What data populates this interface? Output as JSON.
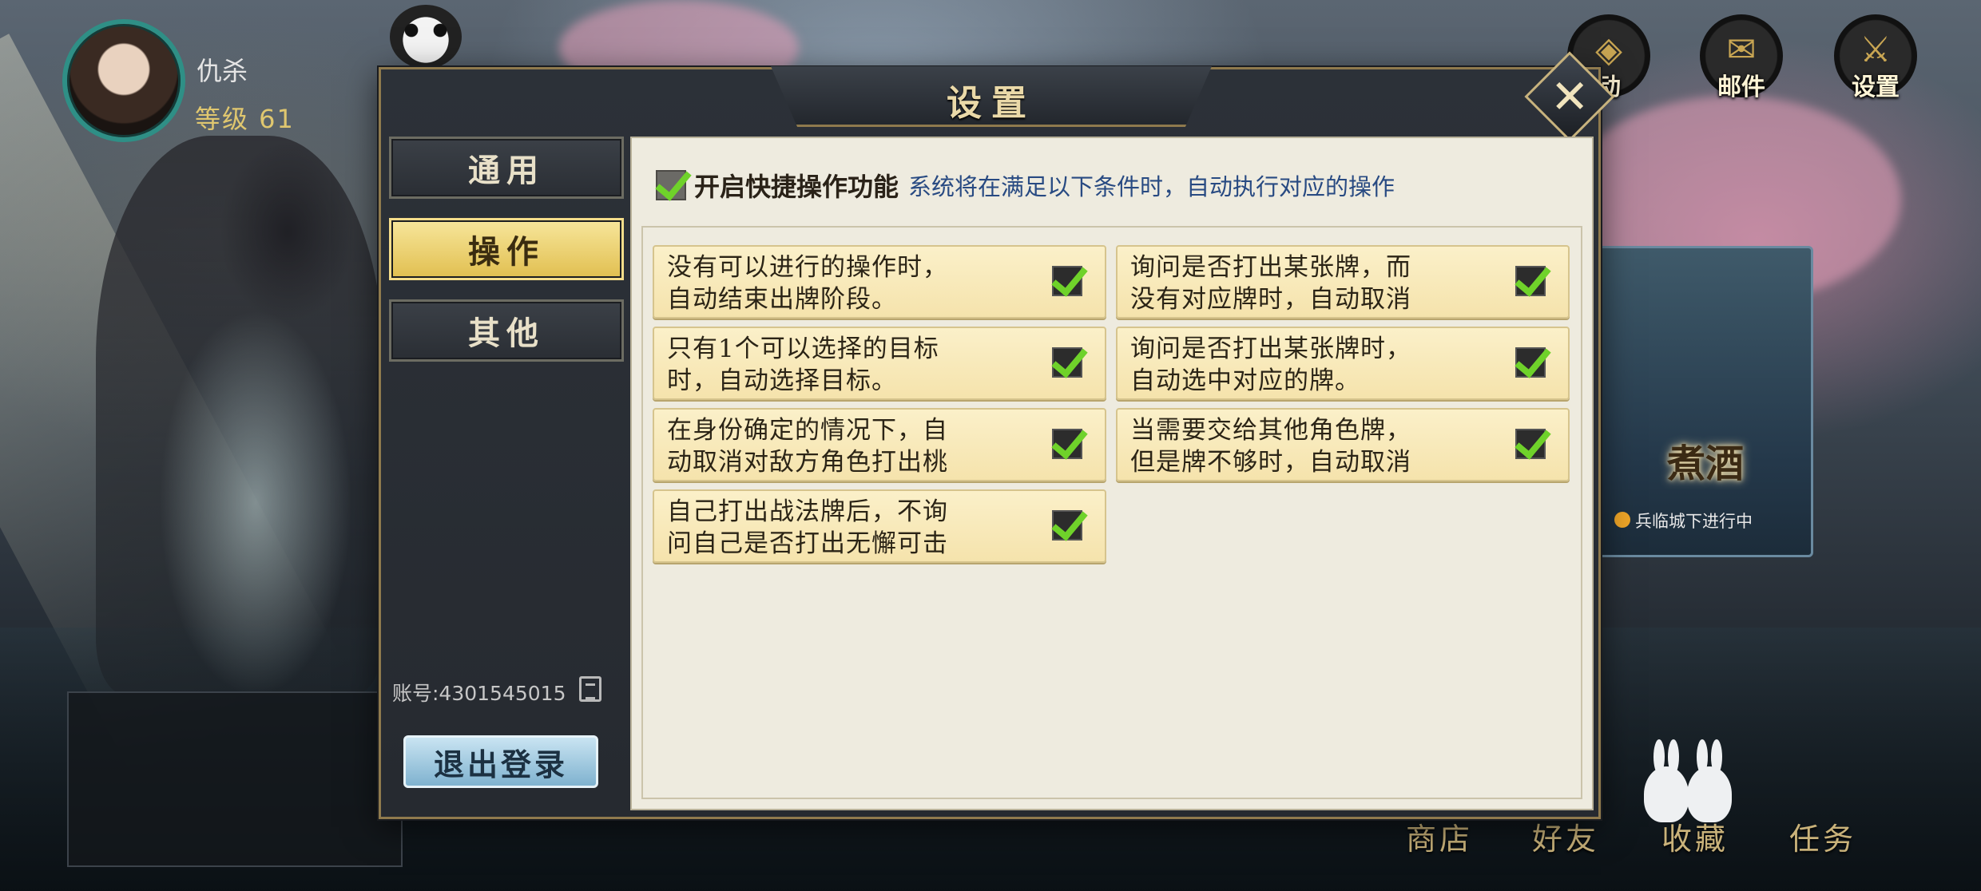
{
  "player": {
    "name": "仇杀",
    "level": "等级 61"
  },
  "top_icons": [
    {
      "name": "activity",
      "label": "动"
    },
    {
      "name": "mail",
      "label": "邮件"
    },
    {
      "name": "settings",
      "label": "设置"
    }
  ],
  "event": {
    "title": "煮酒",
    "subtitle": "兵临城下进行中"
  },
  "bottom_nav": [
    "商店",
    "好友",
    "收藏",
    "任务"
  ],
  "dialog": {
    "title": "设置",
    "tabs": [
      {
        "label": "通用",
        "active": false
      },
      {
        "label": "操作",
        "active": true
      },
      {
        "label": "其他",
        "active": false
      }
    ],
    "account": "账号:4301545015",
    "logout_label": "退出登录",
    "master": {
      "label": "开启快捷操作功能",
      "description": "系统将在满足以下条件时，自动执行对应的操作",
      "checked": true
    },
    "options": [
      {
        "line1": "没有可以进行的操作时，",
        "line2": "自动结束出牌阶段。",
        "checked": true
      },
      {
        "line1": "询问是否打出某张牌，而",
        "line2": "没有对应牌时，自动取消",
        "checked": true
      },
      {
        "line1": "只有1个可以选择的目标",
        "line2": "时，自动选择目标。",
        "checked": true
      },
      {
        "line1": "询问是否打出某张牌时，",
        "line2": "自动选中对应的牌。",
        "checked": true
      },
      {
        "line1": "在身份确定的情况下，自",
        "line2": "动取消对敌方角色打出桃",
        "checked": true
      },
      {
        "line1": "当需要交给其他角色牌，",
        "line2": "但是牌不够时，自动取消",
        "checked": true
      },
      {
        "line1": "自己打出战法牌后，不询",
        "line2": "问自己是否打出无懈可击",
        "checked": true
      }
    ]
  },
  "colors": {
    "accent_gold": "#e1bf50",
    "check_green": "#6fd22a",
    "desc_blue": "#284a82"
  }
}
